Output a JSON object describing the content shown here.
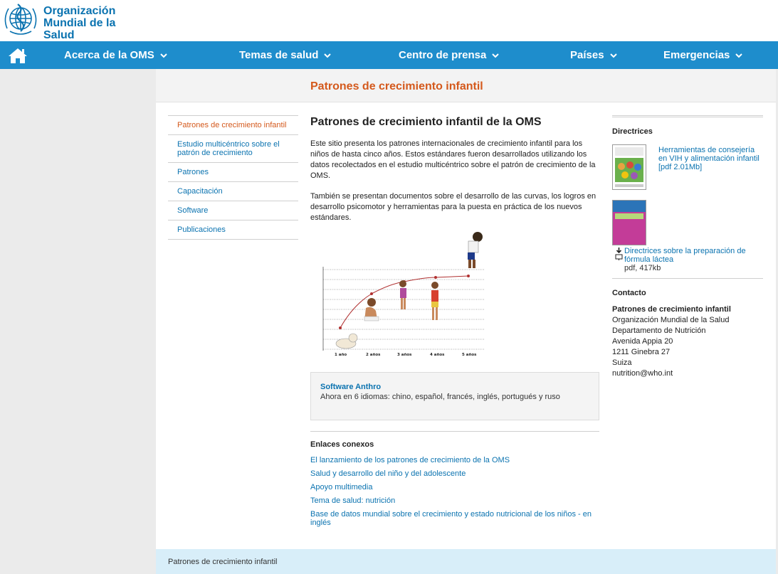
{
  "org": {
    "logo_line1": "Organización",
    "logo_line2": "Mundial de la Salud"
  },
  "nav": {
    "items": [
      {
        "label": "Acerca de la OMS"
      },
      {
        "label": "Temas de salud"
      },
      {
        "label": "Centro de prensa"
      },
      {
        "label": "Países"
      },
      {
        "label": "Emergencias"
      }
    ]
  },
  "page": {
    "header_title": "Patrones de crecimiento infantil"
  },
  "leftnav": {
    "items": [
      {
        "label": "Patrones de crecimiento infantil"
      },
      {
        "label": "Estudio multicéntrico sobre el patrón de crecimiento"
      },
      {
        "label": "Patrones"
      },
      {
        "label": "Capacitación"
      },
      {
        "label": "Software"
      },
      {
        "label": "Publicaciones"
      }
    ]
  },
  "main": {
    "title": "Patrones de crecimiento infantil de la OMS",
    "para1": "Este sitio presenta los patrones internacionales de crecimiento infantil para los niños de hasta cinco años. Estos estándares fueron desarrollados utilizando los datos recolectados en el estudio multicéntrico sobre el patrón de crecimiento de la OMS.",
    "para2": "También se presentan documentos sobre el desarrollo de las curvas, los logros en desarrollo psicomotor y herramientas para la puesta en práctica de los nuevos estándares.",
    "figure_labels": [
      "1 año",
      "2 años",
      "3 años",
      "4 años",
      "5 años"
    ],
    "anthro": {
      "link": "Software Anthro",
      "text": "Ahora en 6 idiomas: chino, español, francés, inglés, portugués y ruso"
    },
    "related": {
      "title": "Enlaces conexos",
      "links": [
        "El lanzamiento de los patrones de crecimiento de la OMS",
        "Salud y desarrollo del niño y del adolescente",
        "Apoyo multimedia",
        "Tema de salud: nutrición",
        "Base de datos mundial sobre el crecimiento y estado nutricional de los niños - en inglés"
      ]
    }
  },
  "right": {
    "directrices_title": "Directrices",
    "doc1_link": "Herramientas de consejería en VIH y alimentación infantil [pdf 2.01Mb]",
    "doc2_link": "Directrices sobre la preparación de fórmula láctea",
    "doc2_size": "pdf, 417kb",
    "contact_title": "Contacto",
    "contact_name": "Patrones de crecimiento infantil",
    "contact_lines": [
      "Organización Mundial de la Salud",
      "Departamento de Nutrición",
      "Avenida Appia 20",
      "1211 Ginebra 27",
      "Suiza"
    ],
    "contact_email": "nutrition@who.int"
  },
  "footer": {
    "text": "Patrones de crecimiento infantil"
  },
  "colors": {
    "brand_blue": "#1e8dcc",
    "accent_orange": "#d4591c",
    "link_blue": "#0b73b0"
  }
}
